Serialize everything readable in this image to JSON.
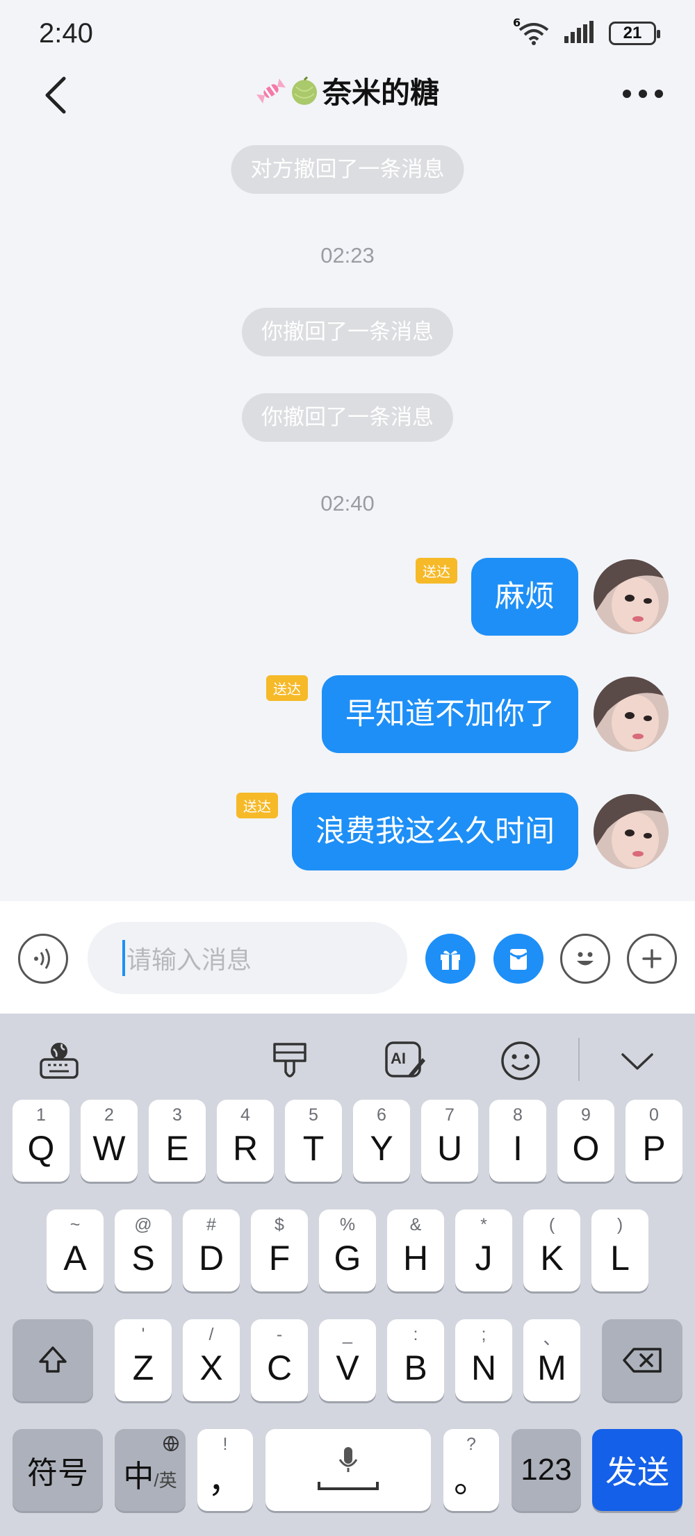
{
  "status": {
    "time": "2:40",
    "network": "6",
    "battery": "21"
  },
  "header": {
    "title": "奈米的糖",
    "back_icon": "chevron-left-icon",
    "more_icon": "ellipsis-icon"
  },
  "chat": {
    "system_recall_other": "对方撤回了一条消息",
    "time_1": "02:23",
    "system_recall_self_1": "你撤回了一条消息",
    "system_recall_self_2": "你撤回了一条消息",
    "time_2": "02:40",
    "messages": [
      {
        "text": "麻烦",
        "status": "送达"
      },
      {
        "text": "早知道不加你了",
        "status": "送达"
      },
      {
        "text": "浪费我这么久时间",
        "status": "送达"
      }
    ]
  },
  "input": {
    "placeholder": "请输入消息"
  },
  "colors": {
    "accent": "#1e8ff6",
    "delivered": "#f6b928",
    "send_key": "#1460e8"
  },
  "keyboard": {
    "row1": [
      {
        "main": "Q",
        "sub": "1"
      },
      {
        "main": "W",
        "sub": "2"
      },
      {
        "main": "E",
        "sub": "3"
      },
      {
        "main": "R",
        "sub": "4"
      },
      {
        "main": "T",
        "sub": "5"
      },
      {
        "main": "Y",
        "sub": "6"
      },
      {
        "main": "U",
        "sub": "7"
      },
      {
        "main": "I",
        "sub": "8"
      },
      {
        "main": "O",
        "sub": "9"
      },
      {
        "main": "P",
        "sub": "0"
      }
    ],
    "row2": [
      {
        "main": "A",
        "sub": "~"
      },
      {
        "main": "S",
        "sub": "@"
      },
      {
        "main": "D",
        "sub": "#"
      },
      {
        "main": "F",
        "sub": "$"
      },
      {
        "main": "G",
        "sub": "%"
      },
      {
        "main": "H",
        "sub": "&"
      },
      {
        "main": "J",
        "sub": "*"
      },
      {
        "main": "K",
        "sub": "("
      },
      {
        "main": "L",
        "sub": ")"
      }
    ],
    "row3": [
      {
        "main": "Z",
        "sub": "'"
      },
      {
        "main": "X",
        "sub": "/"
      },
      {
        "main": "C",
        "sub": "-"
      },
      {
        "main": "V",
        "sub": "_"
      },
      {
        "main": "B",
        "sub": ":"
      },
      {
        "main": "N",
        "sub": ";"
      },
      {
        "main": "M",
        "sub": "、"
      }
    ],
    "symbols": "符号",
    "lang_main": "中",
    "lang_sub": "/英",
    "comma": "，",
    "comma_sub": "!",
    "period": "。",
    "period_sub": "?",
    "numbers": "123",
    "send": "发送"
  }
}
